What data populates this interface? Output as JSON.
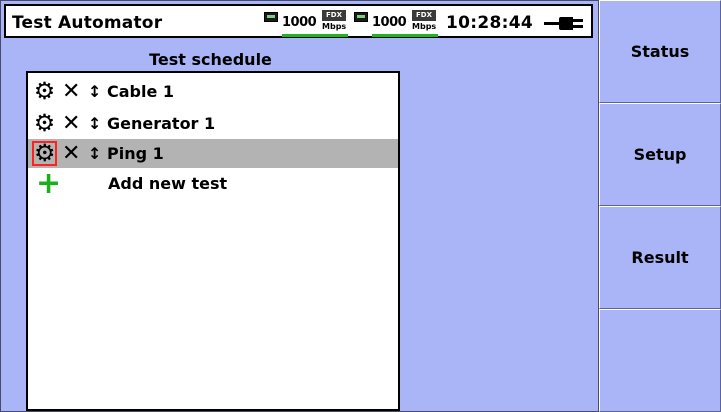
{
  "header": {
    "app_title": "Test Automator",
    "ports": [
      {
        "speed": "1000",
        "duplex": "FDX",
        "unit": "Mbps",
        "icon": "ethernet-port-icon"
      },
      {
        "speed": "1000",
        "duplex": "FDX",
        "unit": "Mbps",
        "icon": "ethernet-port-icon"
      }
    ],
    "time": "10:28:44",
    "power_icon": "ac-power-plug-icon"
  },
  "schedule": {
    "title": "Test schedule",
    "items": [
      {
        "label": "Cable 1",
        "selected": false
      },
      {
        "label": "Generator 1",
        "selected": false
      },
      {
        "label": "Ping 1",
        "selected": true
      }
    ],
    "add_label": "Add new test",
    "icons": {
      "configure": "gear-icon",
      "delete": "x-icon",
      "move": "up-down-arrow-icon",
      "add": "plus-icon"
    }
  },
  "sidebar": {
    "buttons": [
      {
        "label": "Status"
      },
      {
        "label": "Setup"
      },
      {
        "label": "Result"
      },
      {
        "label": ""
      }
    ]
  },
  "colors": {
    "background": "#a9b5f6",
    "selected_row": "#b3b3b3",
    "selected_outline": "#ff2020",
    "add_icon": "#18b018",
    "link_indicator": "#22b122"
  }
}
